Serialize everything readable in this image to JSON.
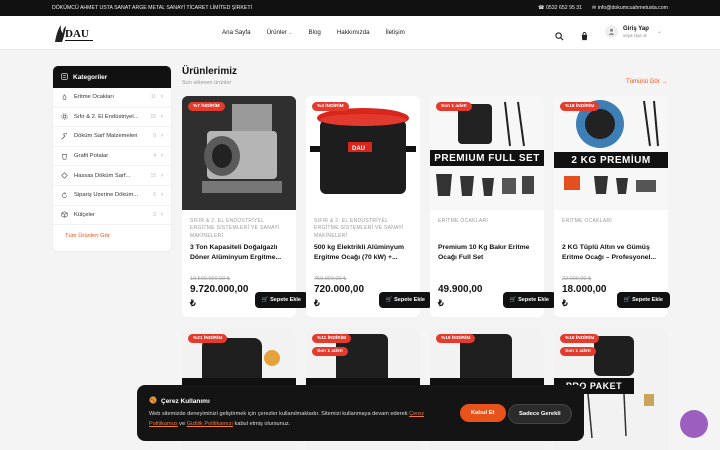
{
  "topbar": {
    "company": "DÖKÜMCÜ AHMET USTA SANAT ARGE METAL SANAYİ TİCARET LİMİTED ŞİRKETİ",
    "phone": "0532 652 95 31",
    "email": "info@dokumcuahmetusta.com"
  },
  "header": {
    "logo_text": "DAU",
    "nav": [
      "Ana Sayfa",
      "Ürünler",
      "Blog",
      "Hakkımızda",
      "İletişim"
    ],
    "user_title": "Giriş Yap",
    "user_sub": "veya Üye ol"
  },
  "sidebar": {
    "title": "Kategoriler",
    "items": [
      {
        "label": "Eritme Ocakları",
        "count": "11",
        "icon": "flame-icon"
      },
      {
        "label": "Sıfır & 2. El Endüstriyel...",
        "count": "15",
        "icon": "gear-icon"
      },
      {
        "label": "Döküm Sarf Malzemeleri",
        "count": "8",
        "icon": "wrench-icon"
      },
      {
        "label": "Grafit Potalar",
        "count": "4",
        "icon": "crucible-icon"
      },
      {
        "label": "Hassas Döküm Sarf...",
        "count": "15",
        "icon": "diamond-icon"
      },
      {
        "label": "Sipariş Üzerine Döküm...",
        "count": "6",
        "icon": "refresh-icon"
      },
      {
        "label": "Külçeler",
        "count": "2",
        "icon": "cube-icon"
      }
    ],
    "all_label": "Tüm Ürünleri Gör"
  },
  "products": {
    "title": "Ürünlerimiz",
    "subtitle": "Son eklenen ürünler",
    "see_all": "Tümünü Gör",
    "cart_label": "Sepete Ekle",
    "currency": "₺",
    "items": [
      {
        "badge": "%7 İNDİRİM",
        "category": "SIFIR & 2. EL ENDÜSTRİYEL ERGİTME SİSTEMLERİ VE SANAYİ MAKİNELERİ",
        "name": "3 Ton Kapasiteli Doğalgazlı Döner Alüminyum Ergitme...",
        "old_price": "10.500.000,00 ₺",
        "price": "9.720.000,00"
      },
      {
        "badge": "%4 İNDİRİM",
        "category": "SIFIR & 2. EL ENDÜSTRİYEL ERGİTME SİSTEMLERİ VE SANAYİ MAKİNELERİ",
        "name": "500 kg Elektrikli Alüminyum Ergitme Ocağı (70 kW) +...",
        "old_price": "750.000,00 ₺",
        "price": "720.000,00"
      },
      {
        "badge": "Son 1 adet!",
        "category": "ERİTME OCAKLARI",
        "name": "Premium 10 Kg Bakır Eritme Ocağı Full Set",
        "old_price": "",
        "price": "49.900,00",
        "img_text": "PREMIUM  FULL SET"
      },
      {
        "badge": "%18 İNDİRİM",
        "category": "ERİTME OCAKLARI",
        "name": "2 KG Tüplü Altın ve Gümüş Eritme Ocağı – Profesyonel...",
        "old_price": "22.000,00 ₺",
        "price": "18.000,00",
        "img_text": "2 KG PREMİUM"
      }
    ],
    "row2": [
      {
        "badge": "%21 İNDİRİM",
        "badge2": ""
      },
      {
        "badge": "%11 İNDİRİM",
        "badge2": "Son 1 adet!"
      },
      {
        "badge": "%19 İNDİRİM",
        "badge2": ""
      },
      {
        "badge": "%10 İNDİRİM",
        "badge2": "Son 1 adet!",
        "img_text": "PRO PAKET"
      }
    ]
  },
  "cookie": {
    "title": "Çerez Kullanımı",
    "text_1": "Web sitemizde deneyiminizi geliştirmek için çerezler kullanılmaktadır. Sitemizi kullanmaya devam ederek",
    "link_1": "Çerez Politikamızı",
    "text_2": "ve",
    "link_2": "Gizlilik Politikamızı",
    "text_3": "kabul etmiş olursunuz.",
    "accept": "Kabul Et",
    "necessary": "Sadece Gerekli"
  },
  "colors": {
    "accent": "#e8531c",
    "badge": "#e33b2e",
    "dark": "#111111",
    "chat": "#9b5fc0"
  }
}
